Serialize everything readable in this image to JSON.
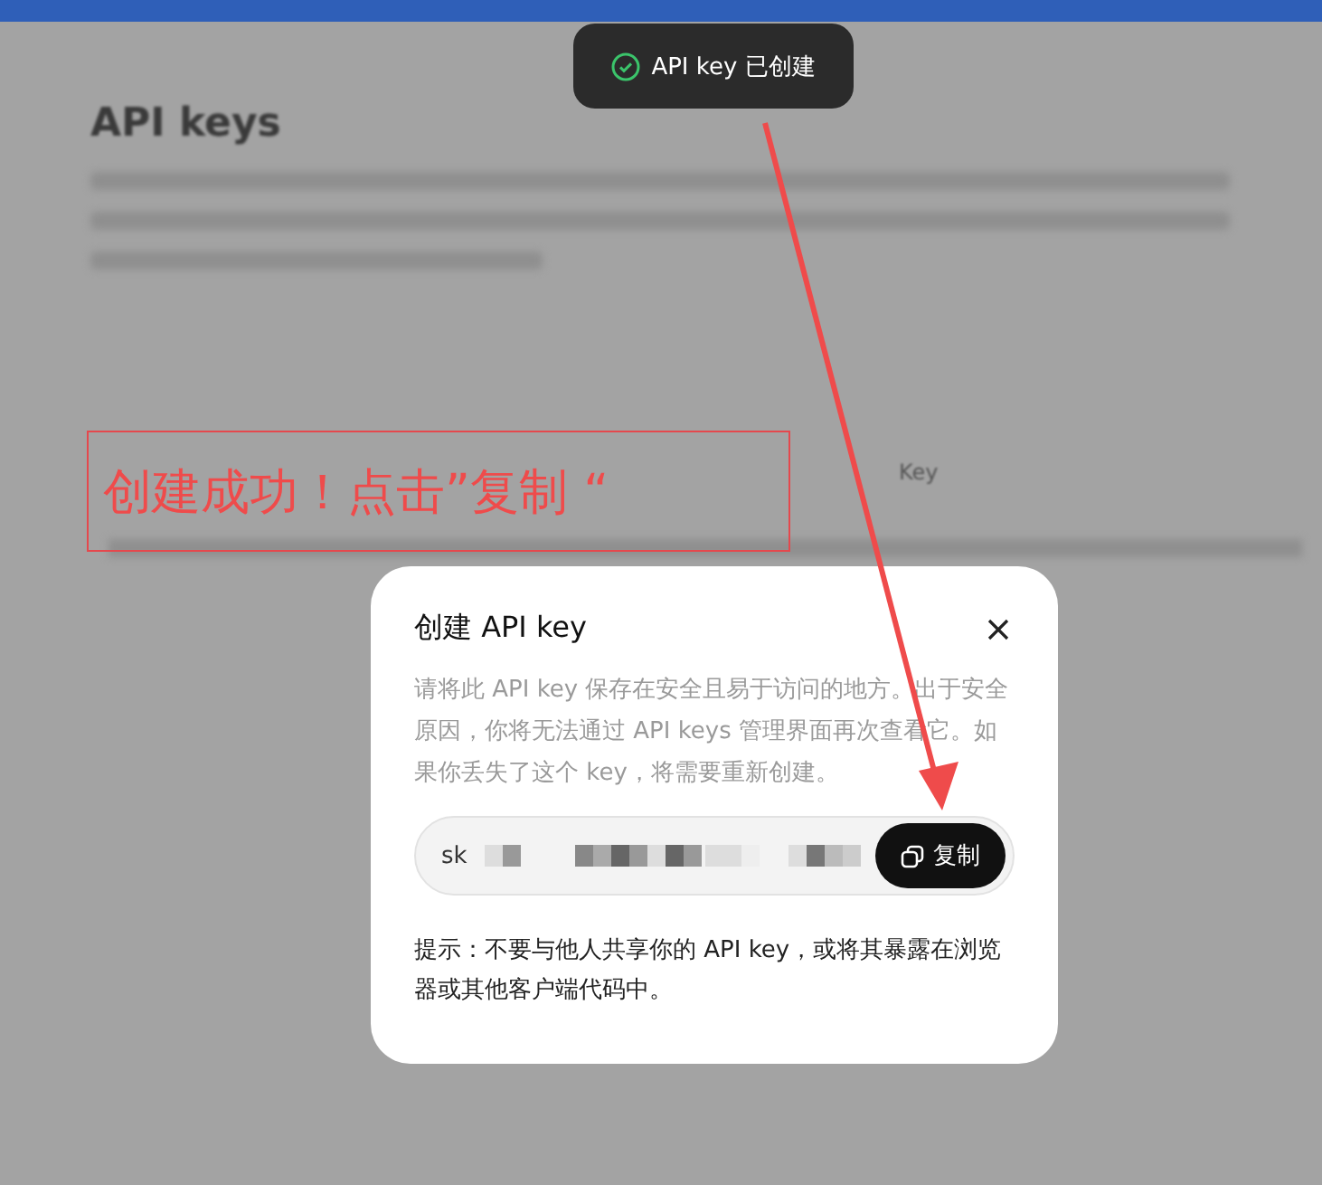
{
  "page": {
    "title": "API keys",
    "table_header": "Key"
  },
  "toast": {
    "text": "API key 已创建"
  },
  "annotation": {
    "text": "创建成功！点击”复制 “"
  },
  "dialog": {
    "title": "创建 API key",
    "description": "请将此 API key 保存在安全且易于访问的地方。出于安全原因，你将无法通过 API keys 管理界面再次查看它。如果你丢失了这个 key，将需要重新创建。",
    "key_prefix": "sk",
    "copy_button": "复制",
    "tip": "提示：不要与他人共享你的 API key，或将其暴露在浏览器或其他客户端代码中。"
  }
}
